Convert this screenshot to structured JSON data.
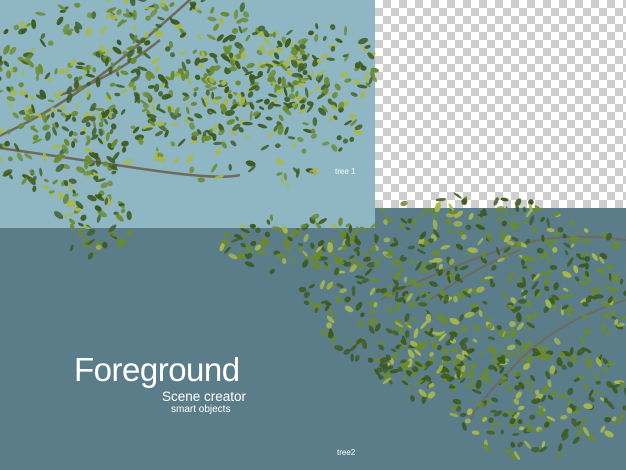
{
  "labels": {
    "tree1": "tree 1",
    "tree2": "tree2"
  },
  "title": {
    "heading": "Foreground",
    "subtitle": "Scene creator",
    "caption": "smart objects"
  },
  "colors": {
    "sky_panel": "#8fb6c3",
    "ground_panel": "#5b7d8a",
    "checker_light": "#ffffff",
    "checker_dark": "#cfcfcf",
    "leaf_dark": "#3d5a1e",
    "leaf_mid": "#6b8a2e",
    "leaf_light": "#a9b84a",
    "branch": "#6f6a5a"
  }
}
